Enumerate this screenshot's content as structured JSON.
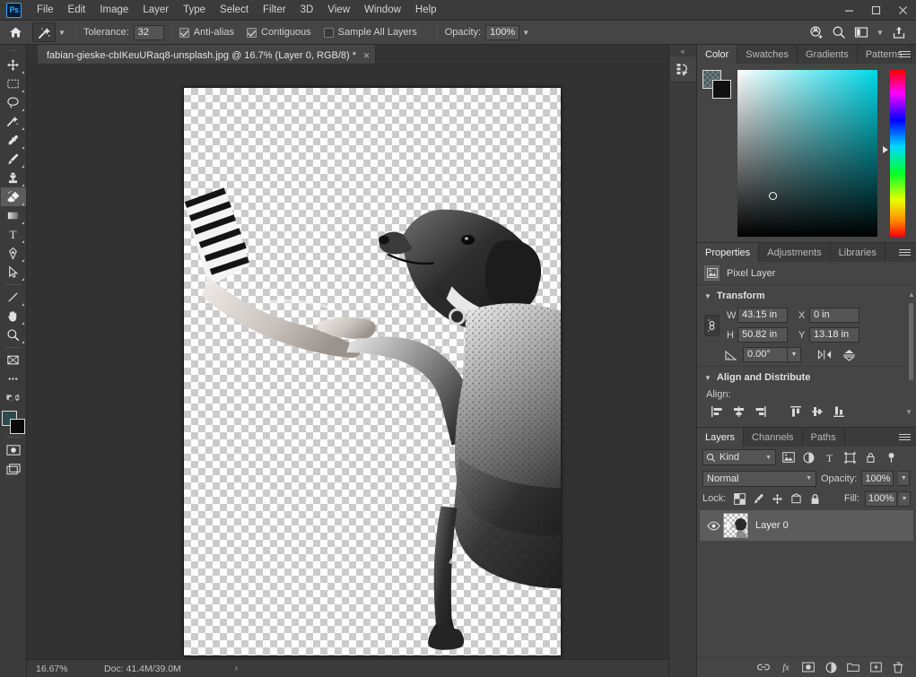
{
  "app": {
    "name": "Adobe Photoshop",
    "logo_text": "Ps",
    "accent": "#31a8ff"
  },
  "menubar": {
    "items": [
      {
        "label": "File"
      },
      {
        "label": "Edit"
      },
      {
        "label": "Image"
      },
      {
        "label": "Layer"
      },
      {
        "label": "Type"
      },
      {
        "label": "Select"
      },
      {
        "label": "Filter"
      },
      {
        "label": "3D"
      },
      {
        "label": "View"
      },
      {
        "label": "Window"
      },
      {
        "label": "Help"
      }
    ],
    "window_controls": {
      "minimize": "minimize-icon",
      "maximize": "maximize-icon",
      "close": "close-icon"
    }
  },
  "options_bar": {
    "home_icon": "home-icon",
    "tool_icon": "magic-wand-icon",
    "tool_preset_caret": "chevron-down-icon",
    "tolerance_label": "Tolerance:",
    "tolerance_value": "32",
    "antialias_label": "Anti-alias",
    "antialias_checked": true,
    "contiguous_label": "Contiguous",
    "contiguous_checked": true,
    "sample_all_layers_label": "Sample All Layers",
    "sample_all_layers_checked": false,
    "opacity_label": "Opacity:",
    "opacity_value": "100%",
    "opacity_caret": "chevron-down-icon",
    "right_icons": [
      "share-cloud-icon",
      "search-icon",
      "workspace-icon",
      "chevron-down-icon",
      "export-icon"
    ]
  },
  "toolbar": {
    "grip": "drag-grip-icon",
    "tools": [
      {
        "name": "move-tool",
        "icon": "move-icon",
        "active": false
      },
      {
        "name": "rectangular-marquee-tool",
        "icon": "marquee-icon",
        "active": false
      },
      {
        "name": "lasso-tool",
        "icon": "lasso-icon",
        "active": false
      },
      {
        "name": "object-selection-tool",
        "icon": "quick-select-icon",
        "active": false
      },
      {
        "name": "eyedropper-tool",
        "icon": "eyedropper-icon",
        "active": false
      },
      {
        "name": "brush-tool",
        "icon": "brush-icon",
        "active": false
      },
      {
        "name": "clone-stamp-tool",
        "icon": "stamp-icon",
        "active": false
      },
      {
        "name": "eraser-tool",
        "icon": "eraser-icon",
        "active": true
      },
      {
        "name": "gradient-tool",
        "icon": "gradient-icon",
        "active": false
      },
      {
        "name": "type-tool",
        "icon": "type-icon",
        "active": false
      },
      {
        "name": "pen-tool",
        "icon": "pen-icon",
        "active": false
      },
      {
        "name": "path-selection-tool",
        "icon": "arrow-select-icon",
        "active": false
      },
      {
        "name": "line-tool",
        "icon": "line-icon",
        "active": false
      },
      {
        "name": "hand-tool",
        "icon": "hand-icon",
        "active": false
      },
      {
        "name": "zoom-tool",
        "icon": "zoom-icon",
        "active": false
      },
      {
        "name": "frame-tool",
        "icon": "frame-icon",
        "active": false
      },
      {
        "name": "edit-toolbar",
        "icon": "ellipsis-icon",
        "active": false
      },
      {
        "name": "default-colors",
        "icon": "default-colors-icon",
        "active": false
      },
      {
        "name": "swap-colors",
        "icon": "swap-colors-icon",
        "active": false
      }
    ],
    "foreground_color": "#586666",
    "background_color": "#0a0a0a",
    "quick_mask": "quick-mask-icon",
    "screen_mode": "screen-mode-icon"
  },
  "document": {
    "tab_title": "fabian-gieske-cbIKeuURaq8-unsplash.jpg @ 16.7% (Layer 0, RGB/8) *",
    "close_glyph": "×",
    "canvas_description": "Black and white photograph of a dog shaking paws with a person's hand, isolated on transparent checkerboard background"
  },
  "status_bar": {
    "zoom": "16.67%",
    "doc_label": "Doc: 41.4M/39.0M",
    "expand_caret": "›"
  },
  "mini_dock": {
    "collapse_icon": "double-chevron-left-icon",
    "items": [
      {
        "name": "history-panel",
        "icon": "history-icon"
      }
    ]
  },
  "color_panel": {
    "tabs": [
      {
        "label": "Color",
        "active": true
      },
      {
        "label": "Swatches",
        "active": false
      },
      {
        "label": "Gradients",
        "active": false
      },
      {
        "label": "Patterns",
        "active": false
      }
    ],
    "menu_icon": "panel-menu-icon",
    "foreground_swatch": "#4e5c5c",
    "background_swatch": "#101010",
    "field_hue": "#00d8e8",
    "picker_marker": "color-picker-ring"
  },
  "properties_panel": {
    "tabs": [
      {
        "label": "Properties",
        "active": true
      },
      {
        "label": "Adjustments",
        "active": false
      },
      {
        "label": "Libraries",
        "active": false
      }
    ],
    "menu_icon": "panel-menu-icon",
    "header_label": "Pixel Layer",
    "header_icon": "pixel-layer-icon",
    "transform": {
      "section_label": "Transform",
      "link_icon": "link-aspect-ratio-icon",
      "w_label": "W",
      "w_value": "43.15 in",
      "h_label": "H",
      "h_value": "50.82 in",
      "x_label": "X",
      "x_value": "0 in",
      "y_label": "Y",
      "y_value": "13.18 in",
      "angle_icon": "angle-icon",
      "angle_value": "0.00°",
      "angle_caret": "chevron-down-icon",
      "flip_horizontal_icon": "flip-horizontal-icon",
      "flip_vertical_icon": "flip-vertical-icon"
    },
    "align": {
      "section_label": "Align and Distribute",
      "align_label": "Align:",
      "icons": [
        "align-left-edges-icon",
        "align-horizontal-centers-icon",
        "align-right-edges-icon",
        "align-top-edges-icon",
        "align-vertical-centers-icon",
        "align-bottom-edges-icon"
      ],
      "more_caret": "chevron-down-icon"
    }
  },
  "layers_panel": {
    "tabs": [
      {
        "label": "Layers",
        "active": true
      },
      {
        "label": "Channels",
        "active": false
      },
      {
        "label": "Paths",
        "active": false
      }
    ],
    "menu_icon": "panel-menu-icon",
    "filter": {
      "search_icon": "search-icon",
      "kind_label": "Kind",
      "kind_caret": "chevron-down-icon",
      "type_icons": [
        "filter-pixel-icon",
        "filter-adjustment-icon",
        "filter-type-icon",
        "filter-shape-icon",
        "filter-smart-object-icon"
      ],
      "toggle_icon": "filter-toggle-icon"
    },
    "blend_mode": "Normal",
    "blend_caret": "chevron-down-icon",
    "opacity_label": "Opacity:",
    "opacity_value": "100%",
    "opacity_caret": "chevron-down-icon",
    "lock_label": "Lock:",
    "lock_icons": [
      "lock-transparent-pixels-icon",
      "lock-image-pixels-icon",
      "lock-position-icon",
      "lock-artboard-nesting-icon",
      "lock-all-icon"
    ],
    "fill_label": "Fill:",
    "fill_value": "100%",
    "fill_caret": "chevron-down-icon",
    "layers": [
      {
        "name": "Layer 0",
        "visible": true,
        "eye_icon": "eye-icon",
        "selected": true
      }
    ],
    "footer_icons": [
      "link-layers-icon",
      "layer-style-fx-icon",
      "layer-mask-icon",
      "adjustment-layer-icon",
      "new-group-icon",
      "new-layer-icon",
      "delete-layer-icon"
    ]
  }
}
